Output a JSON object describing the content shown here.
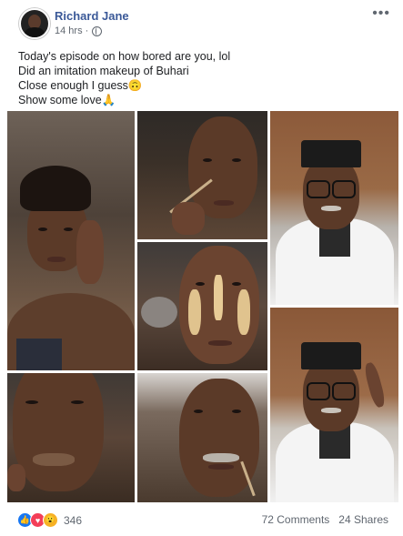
{
  "post": {
    "author": "Richard Jane",
    "time": "14 hrs ·",
    "lines": [
      "Today's episode on how bored are you, lol",
      "Did an imitation makeup of Buhari",
      "Close enough I guess🙃",
      "Show some love🙏"
    ],
    "privacy_icon": "globe-icon",
    "more_icon": "more-options-icon"
  },
  "photos": [
    "woman-face-photo",
    "makeup-application-photo",
    "contour-makeup-photo",
    "lips-closeup-photo",
    "mustache-makeup-photo",
    "buhari-imitation-photo-1",
    "buhari-imitation-photo-2"
  ],
  "footer": {
    "reaction_icons": [
      "like-icon",
      "love-icon",
      "wow-icon"
    ],
    "reaction_count": "346",
    "comments": "72 Comments",
    "shares": "24 Shares"
  },
  "colors": {
    "author": "#3b5998",
    "meta": "#606770",
    "like": "#1877f2",
    "love": "#f33e58",
    "wow": "#f7b125"
  }
}
